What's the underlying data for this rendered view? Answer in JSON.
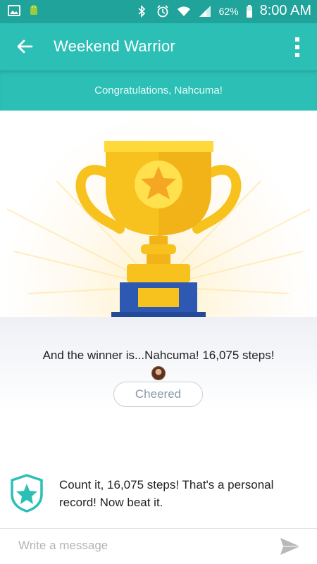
{
  "status_bar": {
    "battery": "62%",
    "time": "8:00 AM",
    "icons": [
      "image-icon",
      "android-icon",
      "bluetooth-icon",
      "alarm-icon",
      "wifi-icon",
      "signal-icon",
      "battery-icon"
    ]
  },
  "toolbar": {
    "title": "Weekend Warrior",
    "back_icon": "arrow-left-icon",
    "menu_icon": "more-vert-icon"
  },
  "banner": {
    "text": "Congratulations, Nahcuma!"
  },
  "result": {
    "winner_text": "And the winner is...Nahcuma! 16,075 steps!",
    "cheer_button": "Cheered"
  },
  "record": {
    "text": "Count it, 16,075 steps! That's a personal record! Now beat it."
  },
  "message": {
    "placeholder": "Write a message"
  },
  "colors": {
    "teal": "#2bbfb6",
    "teal_dark": "#1fa39a",
    "trophy_gold": "#f7c21e",
    "trophy_base": "#2d59b2"
  }
}
